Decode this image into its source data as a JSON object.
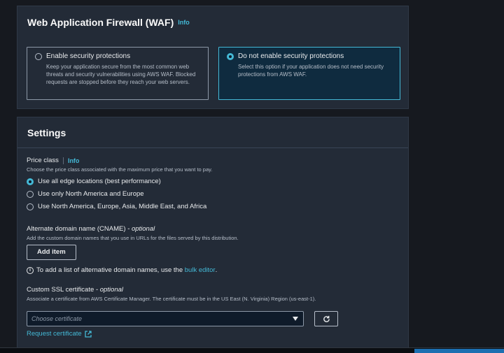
{
  "waf": {
    "title": "Web Application Firewall (WAF)",
    "info": "Info",
    "options": [
      {
        "title": "Enable security protections",
        "desc": "Keep your application secure from the most common web threats and security vulnerabilities using AWS WAF. Blocked requests are stopped before they reach your web servers.",
        "selected": false
      },
      {
        "title": "Do not enable security protections",
        "desc": "Select this option if your application does not need security protections from AWS WAF.",
        "selected": true
      }
    ]
  },
  "settings": {
    "title": "Settings",
    "price_class": {
      "label": "Price class",
      "info": "Info",
      "desc": "Choose the price class associated with the maximum price that you want to pay.",
      "options": [
        {
          "label": "Use all edge locations (best performance)",
          "selected": true
        },
        {
          "label": "Use only North America and Europe",
          "selected": false
        },
        {
          "label": "Use North America, Europe, Asia, Middle East, and Africa",
          "selected": false
        }
      ]
    },
    "cname": {
      "label": "Alternate domain name (CNAME)",
      "optional": "- optional",
      "desc": "Add the custom domain names that you use in URLs for the files served by this distribution.",
      "add_button": "Add item",
      "hint_prefix": "To add a list of alternative domain names, use the",
      "hint_link": "bulk editor",
      "hint_suffix": "."
    },
    "ssl": {
      "label": "Custom SSL certificate",
      "optional": "- optional",
      "desc": "Associate a certificate from AWS Certificate Manager. The certificate must be in the US East (N. Virginia) Region (us-east-1).",
      "placeholder": "Choose certificate",
      "request_link": "Request certificate"
    }
  },
  "colors": {
    "accent": "#44b9d6",
    "panel": "#232b37",
    "background": "#16191f"
  },
  "icons": [
    "info-circle-icon",
    "caret-down-icon",
    "refresh-icon",
    "external-link-icon"
  ]
}
